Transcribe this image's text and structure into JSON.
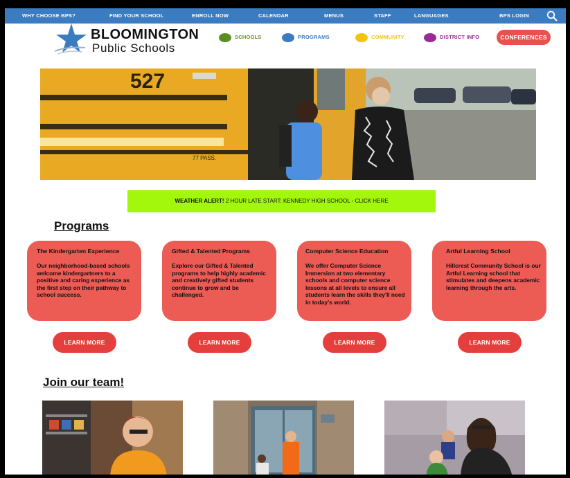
{
  "top_nav": [
    {
      "label": "Why Choose BPS?"
    },
    {
      "label": "Find Your School"
    },
    {
      "label": "Enroll Now"
    },
    {
      "label": "Calendar"
    },
    {
      "label": "Menus"
    },
    {
      "label": "Staff"
    },
    {
      "label": "Languages"
    },
    {
      "label": "BPS Login"
    }
  ],
  "logo": {
    "title": "BLOOMINGTON",
    "subtitle": "Public Schools"
  },
  "main_nav": [
    {
      "label": "Schools",
      "color": "#5a8f1f"
    },
    {
      "label": "Programs",
      "color": "#3b7bbf"
    },
    {
      "label": "Community",
      "color": "#f2c40b"
    },
    {
      "label": "District Info",
      "color": "#9a2a96"
    }
  ],
  "conferences_label": "Conferences",
  "hero": {
    "bus_number": "527",
    "pass_text": "77 PASS."
  },
  "alert": {
    "strong": "WEATHER ALERT!",
    "text": "2 HOUR LATE START: KENNEDY HIGH SCHOOL - CLICK HERE"
  },
  "programs": {
    "heading": "Programs",
    "cards": [
      {
        "title": "The Kindergarten Experience",
        "body": "Our neighborhood-based schools welcome kindergartners to a positive and caring experience as the first step on their pathway to school success."
      },
      {
        "title": "Gifted & Talented Programs",
        "body": "Explore our Gifted & Talented programs to help highly academic and creatively gifted students continue to grow and be challenged."
      },
      {
        "title": "Computer Science Education",
        "body": "We offer Computer Science Immersion at two elementary schools and computer science lessons at all levels to ensure all students learn the skills they'll need in today's world."
      },
      {
        "title": "Artful Learning School",
        "body": "Hillcrest Community School is our Artful Learning school that stimulates and deepens academic learning through the arts."
      }
    ],
    "learn_more_label": "Learn More"
  },
  "team": {
    "heading": "Join our team!"
  },
  "colors": {
    "topbar": "#3b7bbf",
    "accent_red": "#e8524e",
    "card": "#ed5b55",
    "alert": "#a2f70c"
  }
}
